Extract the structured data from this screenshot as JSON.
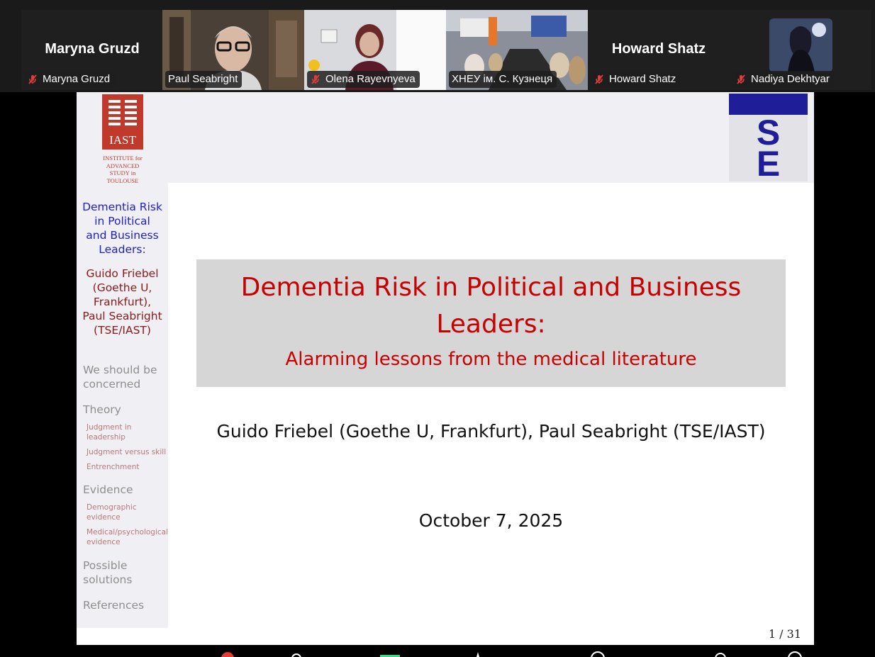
{
  "participants": [
    {
      "display": "Maryna Gruzd",
      "tag": "Maryna Gruzd",
      "video": false,
      "active": false,
      "muted": true
    },
    {
      "display": "",
      "tag": "Paul Seabright",
      "video": true,
      "active": true,
      "muted": false
    },
    {
      "display": "",
      "tag": "Olena Rayevnyeva",
      "video": true,
      "active": false,
      "muted": true
    },
    {
      "display": "",
      "tag": "ХНЕУ ім. С. Кузнеця",
      "video": true,
      "active": false,
      "muted": false
    },
    {
      "display": "Howard Shatz",
      "tag": "Howard Shatz",
      "video": false,
      "active": false,
      "muted": true
    },
    {
      "display": "",
      "tag": "Nadiya Dekhtyar",
      "video": false,
      "active": false,
      "muted": true
    }
  ],
  "slide": {
    "logo_left_text": "IAST",
    "logo_left_caption": [
      "INSTITUTE for",
      "ADVANCED",
      "STUDY in",
      "TOULOUSE"
    ],
    "logo_right_text": [
      "S",
      "E"
    ],
    "sidebar": {
      "title_lines": [
        "Dementia Risk",
        "in Political",
        "and Business",
        "Leaders:"
      ],
      "author_lines": [
        "Guido Friebel",
        "(Goethe U,",
        "Frankfurt),",
        "Paul Seabright",
        "(TSE/IAST)"
      ],
      "sections": [
        {
          "label_lines": [
            "We should be",
            "concerned"
          ],
          "subs": []
        },
        {
          "label_lines": [
            "Theory"
          ],
          "subs": [
            [
              "Judgment in",
              "leadership"
            ],
            [
              "Judgment versus skill"
            ],
            [
              "Entrenchment"
            ]
          ]
        },
        {
          "label_lines": [
            "Evidence"
          ],
          "subs": [
            [
              "Demographic",
              "evidence"
            ],
            [
              "Medical/psychological",
              "evidence"
            ]
          ]
        },
        {
          "label_lines": [
            "Possible",
            "solutions"
          ],
          "subs": []
        },
        {
          "label_lines": [
            "References"
          ],
          "subs": []
        }
      ]
    },
    "title_lines": [
      "Dementia Risk in Political and Business",
      "Leaders:"
    ],
    "subtitle": "Alarming lessons from the medical literature",
    "authors": "Guido Friebel (Goethe U, Frankfurt), Paul Seabright (TSE/IAST)",
    "date": "October 7, 2025",
    "page": "1 / 31"
  },
  "colors": {
    "title_red": "#c80000",
    "sidebar_blue": "#2020c8",
    "active_speaker": "#3ddc84",
    "se_blue": "#1f1d97",
    "iast_red": "#c0392b"
  },
  "icons": {
    "muted": "mic-muted-icon"
  }
}
